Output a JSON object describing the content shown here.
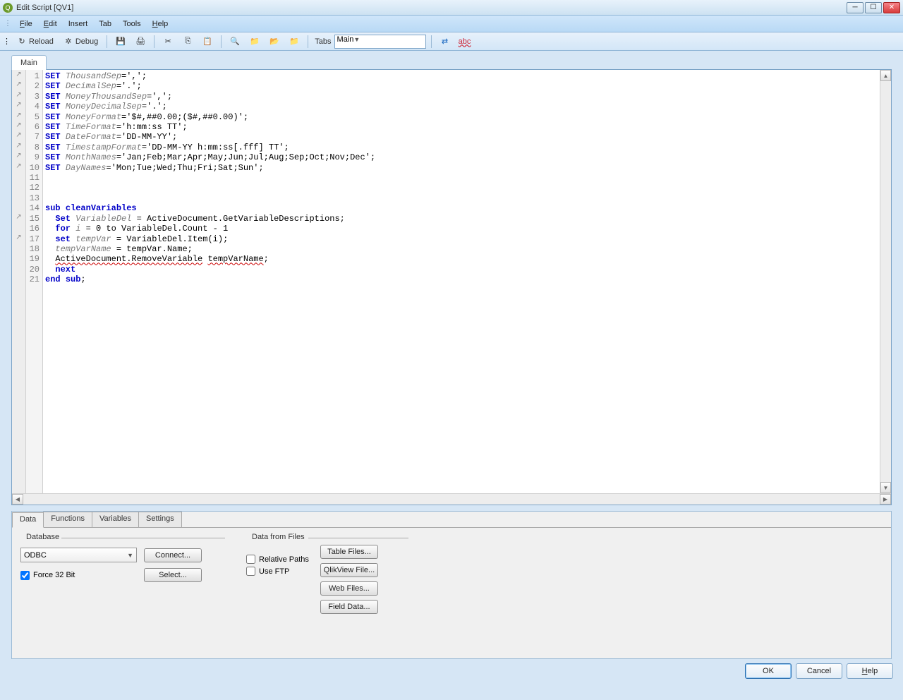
{
  "title": "Edit Script [QV1]",
  "menu": {
    "file": "File",
    "edit": "Edit",
    "insert": "Insert",
    "tab": "Tab",
    "tools": "Tools",
    "help": "Help"
  },
  "toolbar": {
    "reload": "Reload",
    "debug": "Debug",
    "tabs_label": "Tabs",
    "tabs_value": "Main"
  },
  "tab": {
    "main": "Main"
  },
  "code": {
    "lines": [
      {
        "n": 1,
        "tokens": [
          {
            "t": "kw",
            "v": "SET "
          },
          {
            "t": "var",
            "v": "ThousandSep"
          },
          {
            "t": "str",
            "v": "=',';"
          }
        ]
      },
      {
        "n": 2,
        "tokens": [
          {
            "t": "kw",
            "v": "SET "
          },
          {
            "t": "var",
            "v": "DecimalSep"
          },
          {
            "t": "str",
            "v": "='.';"
          }
        ]
      },
      {
        "n": 3,
        "tokens": [
          {
            "t": "kw",
            "v": "SET "
          },
          {
            "t": "var",
            "v": "MoneyThousandSep"
          },
          {
            "t": "str",
            "v": "=',';"
          }
        ]
      },
      {
        "n": 4,
        "tokens": [
          {
            "t": "kw",
            "v": "SET "
          },
          {
            "t": "var",
            "v": "MoneyDecimalSep"
          },
          {
            "t": "str",
            "v": "='.';"
          }
        ]
      },
      {
        "n": 5,
        "tokens": [
          {
            "t": "kw",
            "v": "SET "
          },
          {
            "t": "var",
            "v": "MoneyFormat"
          },
          {
            "t": "str",
            "v": "='$#,##0.00;($#,##0.00)';"
          }
        ]
      },
      {
        "n": 6,
        "tokens": [
          {
            "t": "kw",
            "v": "SET "
          },
          {
            "t": "var",
            "v": "TimeFormat"
          },
          {
            "t": "str",
            "v": "='h:mm:ss TT';"
          }
        ]
      },
      {
        "n": 7,
        "tokens": [
          {
            "t": "kw",
            "v": "SET "
          },
          {
            "t": "var",
            "v": "DateFormat"
          },
          {
            "t": "str",
            "v": "='DD-MM-YY';"
          }
        ]
      },
      {
        "n": 8,
        "tokens": [
          {
            "t": "kw",
            "v": "SET "
          },
          {
            "t": "var",
            "v": "TimestampFormat"
          },
          {
            "t": "str",
            "v": "='DD-MM-YY h:mm:ss[.fff] TT';"
          }
        ]
      },
      {
        "n": 9,
        "tokens": [
          {
            "t": "kw",
            "v": "SET "
          },
          {
            "t": "var",
            "v": "MonthNames"
          },
          {
            "t": "str",
            "v": "='Jan;Feb;Mar;Apr;May;Jun;Jul;Aug;Sep;Oct;Nov;Dec';"
          }
        ]
      },
      {
        "n": 10,
        "tokens": [
          {
            "t": "kw",
            "v": "SET "
          },
          {
            "t": "var",
            "v": "DayNames"
          },
          {
            "t": "str",
            "v": "='Mon;Tue;Wed;Thu;Fri;Sat;Sun';"
          }
        ]
      },
      {
        "n": 11,
        "tokens": [
          {
            "t": "str",
            "v": ""
          }
        ]
      },
      {
        "n": 12,
        "tokens": [
          {
            "t": "str",
            "v": ""
          }
        ]
      },
      {
        "n": 13,
        "tokens": [
          {
            "t": "str",
            "v": ""
          }
        ]
      },
      {
        "n": 14,
        "tokens": [
          {
            "t": "kw",
            "v": "sub "
          },
          {
            "t": "kw",
            "v": "cleanVariables"
          }
        ]
      },
      {
        "n": 15,
        "tokens": [
          {
            "t": "str",
            "v": "  "
          },
          {
            "t": "kw",
            "v": "Set "
          },
          {
            "t": "var",
            "v": "VariableDel"
          },
          {
            "t": "str",
            "v": " = ActiveDocument.GetVariableDescriptions;"
          }
        ]
      },
      {
        "n": 16,
        "tokens": [
          {
            "t": "str",
            "v": "  "
          },
          {
            "t": "kw",
            "v": "for "
          },
          {
            "t": "var",
            "v": "i"
          },
          {
            "t": "str",
            "v": " = 0 to VariableDel.Count - 1"
          }
        ]
      },
      {
        "n": 17,
        "tokens": [
          {
            "t": "str",
            "v": "  "
          },
          {
            "t": "kw",
            "v": "set "
          },
          {
            "t": "var",
            "v": "tempVar"
          },
          {
            "t": "str",
            "v": " = VariableDel.Item(i);"
          }
        ]
      },
      {
        "n": 18,
        "tokens": [
          {
            "t": "str",
            "v": "  "
          },
          {
            "t": "var",
            "v": "tempVarName"
          },
          {
            "t": "str",
            "v": " = tempVar.Name;"
          }
        ]
      },
      {
        "n": 19,
        "tokens": [
          {
            "t": "str",
            "v": "  "
          },
          {
            "t": "squig",
            "v": "ActiveDocument.RemoveVariable"
          },
          {
            "t": "str",
            "v": " "
          },
          {
            "t": "squig",
            "v": "tempVarName"
          },
          {
            "t": "str",
            "v": ";"
          }
        ]
      },
      {
        "n": 20,
        "tokens": [
          {
            "t": "str",
            "v": "  "
          },
          {
            "t": "kw",
            "v": "next"
          }
        ]
      },
      {
        "n": 21,
        "tokens": [
          {
            "t": "kw",
            "v": "end "
          },
          {
            "t": "kw",
            "v": "sub"
          },
          {
            "t": "str",
            "v": ";"
          }
        ]
      }
    ]
  },
  "bottom_tabs": {
    "data": "Data",
    "functions": "Functions",
    "variables": "Variables",
    "settings": "Settings"
  },
  "database": {
    "label": "Database",
    "select_value": "ODBC",
    "connect": "Connect...",
    "select_btn": "Select...",
    "force32": "Force 32 Bit",
    "force32_checked": true
  },
  "datafiles": {
    "label": "Data from Files",
    "relative": "Relative Paths",
    "relative_checked": false,
    "useftp": "Use FTP",
    "useftp_checked": false,
    "table_files": "Table Files...",
    "qlikview_file": "QlikView File...",
    "web_files": "Web Files...",
    "field_data": "Field Data..."
  },
  "dialog": {
    "ok": "OK",
    "cancel": "Cancel",
    "help": "Help"
  }
}
